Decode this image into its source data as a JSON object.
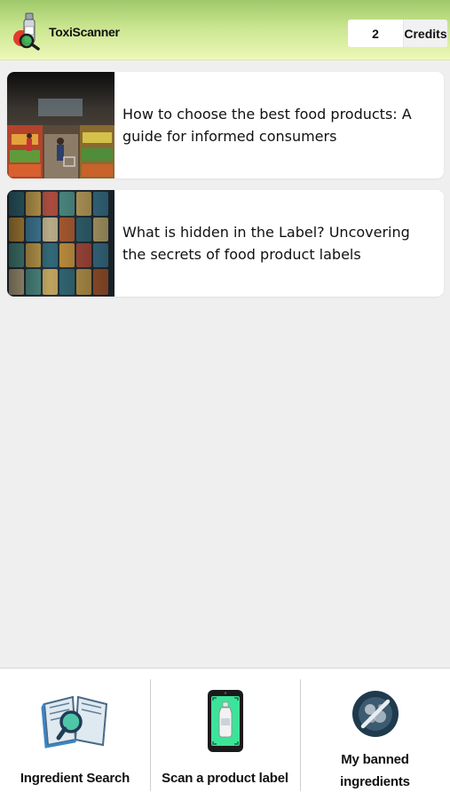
{
  "header": {
    "app_title": "ToxiScanner",
    "credits_count": "2",
    "credits_label": "Credits"
  },
  "articles": [
    {
      "title": "How to choose the best food products: A guide for informed consumers",
      "thumbnail": "supermarket-photo"
    },
    {
      "title": "What is hidden in the Label? Uncovering the secrets of food product labels",
      "thumbnail": "product-labels-photo"
    }
  ],
  "bottom_nav": [
    {
      "label": "Ingredient Search",
      "icon": "book-magnifier-icon"
    },
    {
      "label": "Scan a product label",
      "icon": "phone-scan-icon"
    },
    {
      "label": "My banned ingredients",
      "icon": "banned-icon"
    }
  ],
  "colors": {
    "header_top": "#9fc96a",
    "header_bottom": "#edf8b8",
    "page_bg": "#efefef"
  }
}
